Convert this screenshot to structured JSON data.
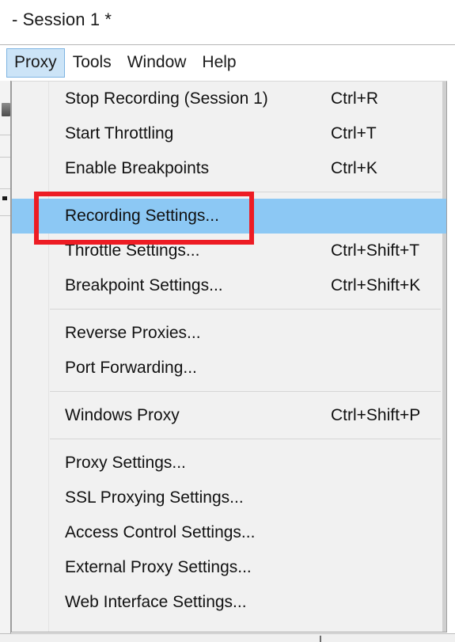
{
  "window": {
    "title": "- Session 1 *"
  },
  "menubar": {
    "items": [
      {
        "label": "Proxy",
        "open": true
      },
      {
        "label": "Tools",
        "open": false
      },
      {
        "label": "Window",
        "open": false
      },
      {
        "label": "Help",
        "open": false
      }
    ]
  },
  "dropdown": {
    "owner": "Proxy",
    "highlight_color": "#8cc8f4",
    "menubar_open_color": "#cce4f7",
    "annotation_color": "#ed1c24",
    "items": [
      {
        "type": "item",
        "label": "Stop Recording (Session 1)",
        "shortcut": "Ctrl+R",
        "selected": false
      },
      {
        "type": "item",
        "label": "Start Throttling",
        "shortcut": "Ctrl+T",
        "selected": false
      },
      {
        "type": "item",
        "label": "Enable Breakpoints",
        "shortcut": "Ctrl+K",
        "selected": false
      },
      {
        "type": "separator"
      },
      {
        "type": "item",
        "label": "Recording Settings...",
        "shortcut": "",
        "selected": true
      },
      {
        "type": "item",
        "label": "Throttle Settings...",
        "shortcut": "Ctrl+Shift+T",
        "selected": false
      },
      {
        "type": "item",
        "label": "Breakpoint Settings...",
        "shortcut": "Ctrl+Shift+K",
        "selected": false
      },
      {
        "type": "separator"
      },
      {
        "type": "item",
        "label": "Reverse Proxies...",
        "shortcut": "",
        "selected": false
      },
      {
        "type": "item",
        "label": "Port Forwarding...",
        "shortcut": "",
        "selected": false
      },
      {
        "type": "separator"
      },
      {
        "type": "item",
        "label": "Windows Proxy",
        "shortcut": "Ctrl+Shift+P",
        "selected": false
      },
      {
        "type": "separator"
      },
      {
        "type": "item",
        "label": "Proxy Settings...",
        "shortcut": "",
        "selected": false
      },
      {
        "type": "item",
        "label": "SSL Proxying Settings...",
        "shortcut": "",
        "selected": false
      },
      {
        "type": "item",
        "label": "Access Control Settings...",
        "shortcut": "",
        "selected": false
      },
      {
        "type": "item",
        "label": "External Proxy Settings...",
        "shortcut": "",
        "selected": false
      },
      {
        "type": "item",
        "label": "Web Interface Settings...",
        "shortcut": "",
        "selected": false
      }
    ]
  }
}
